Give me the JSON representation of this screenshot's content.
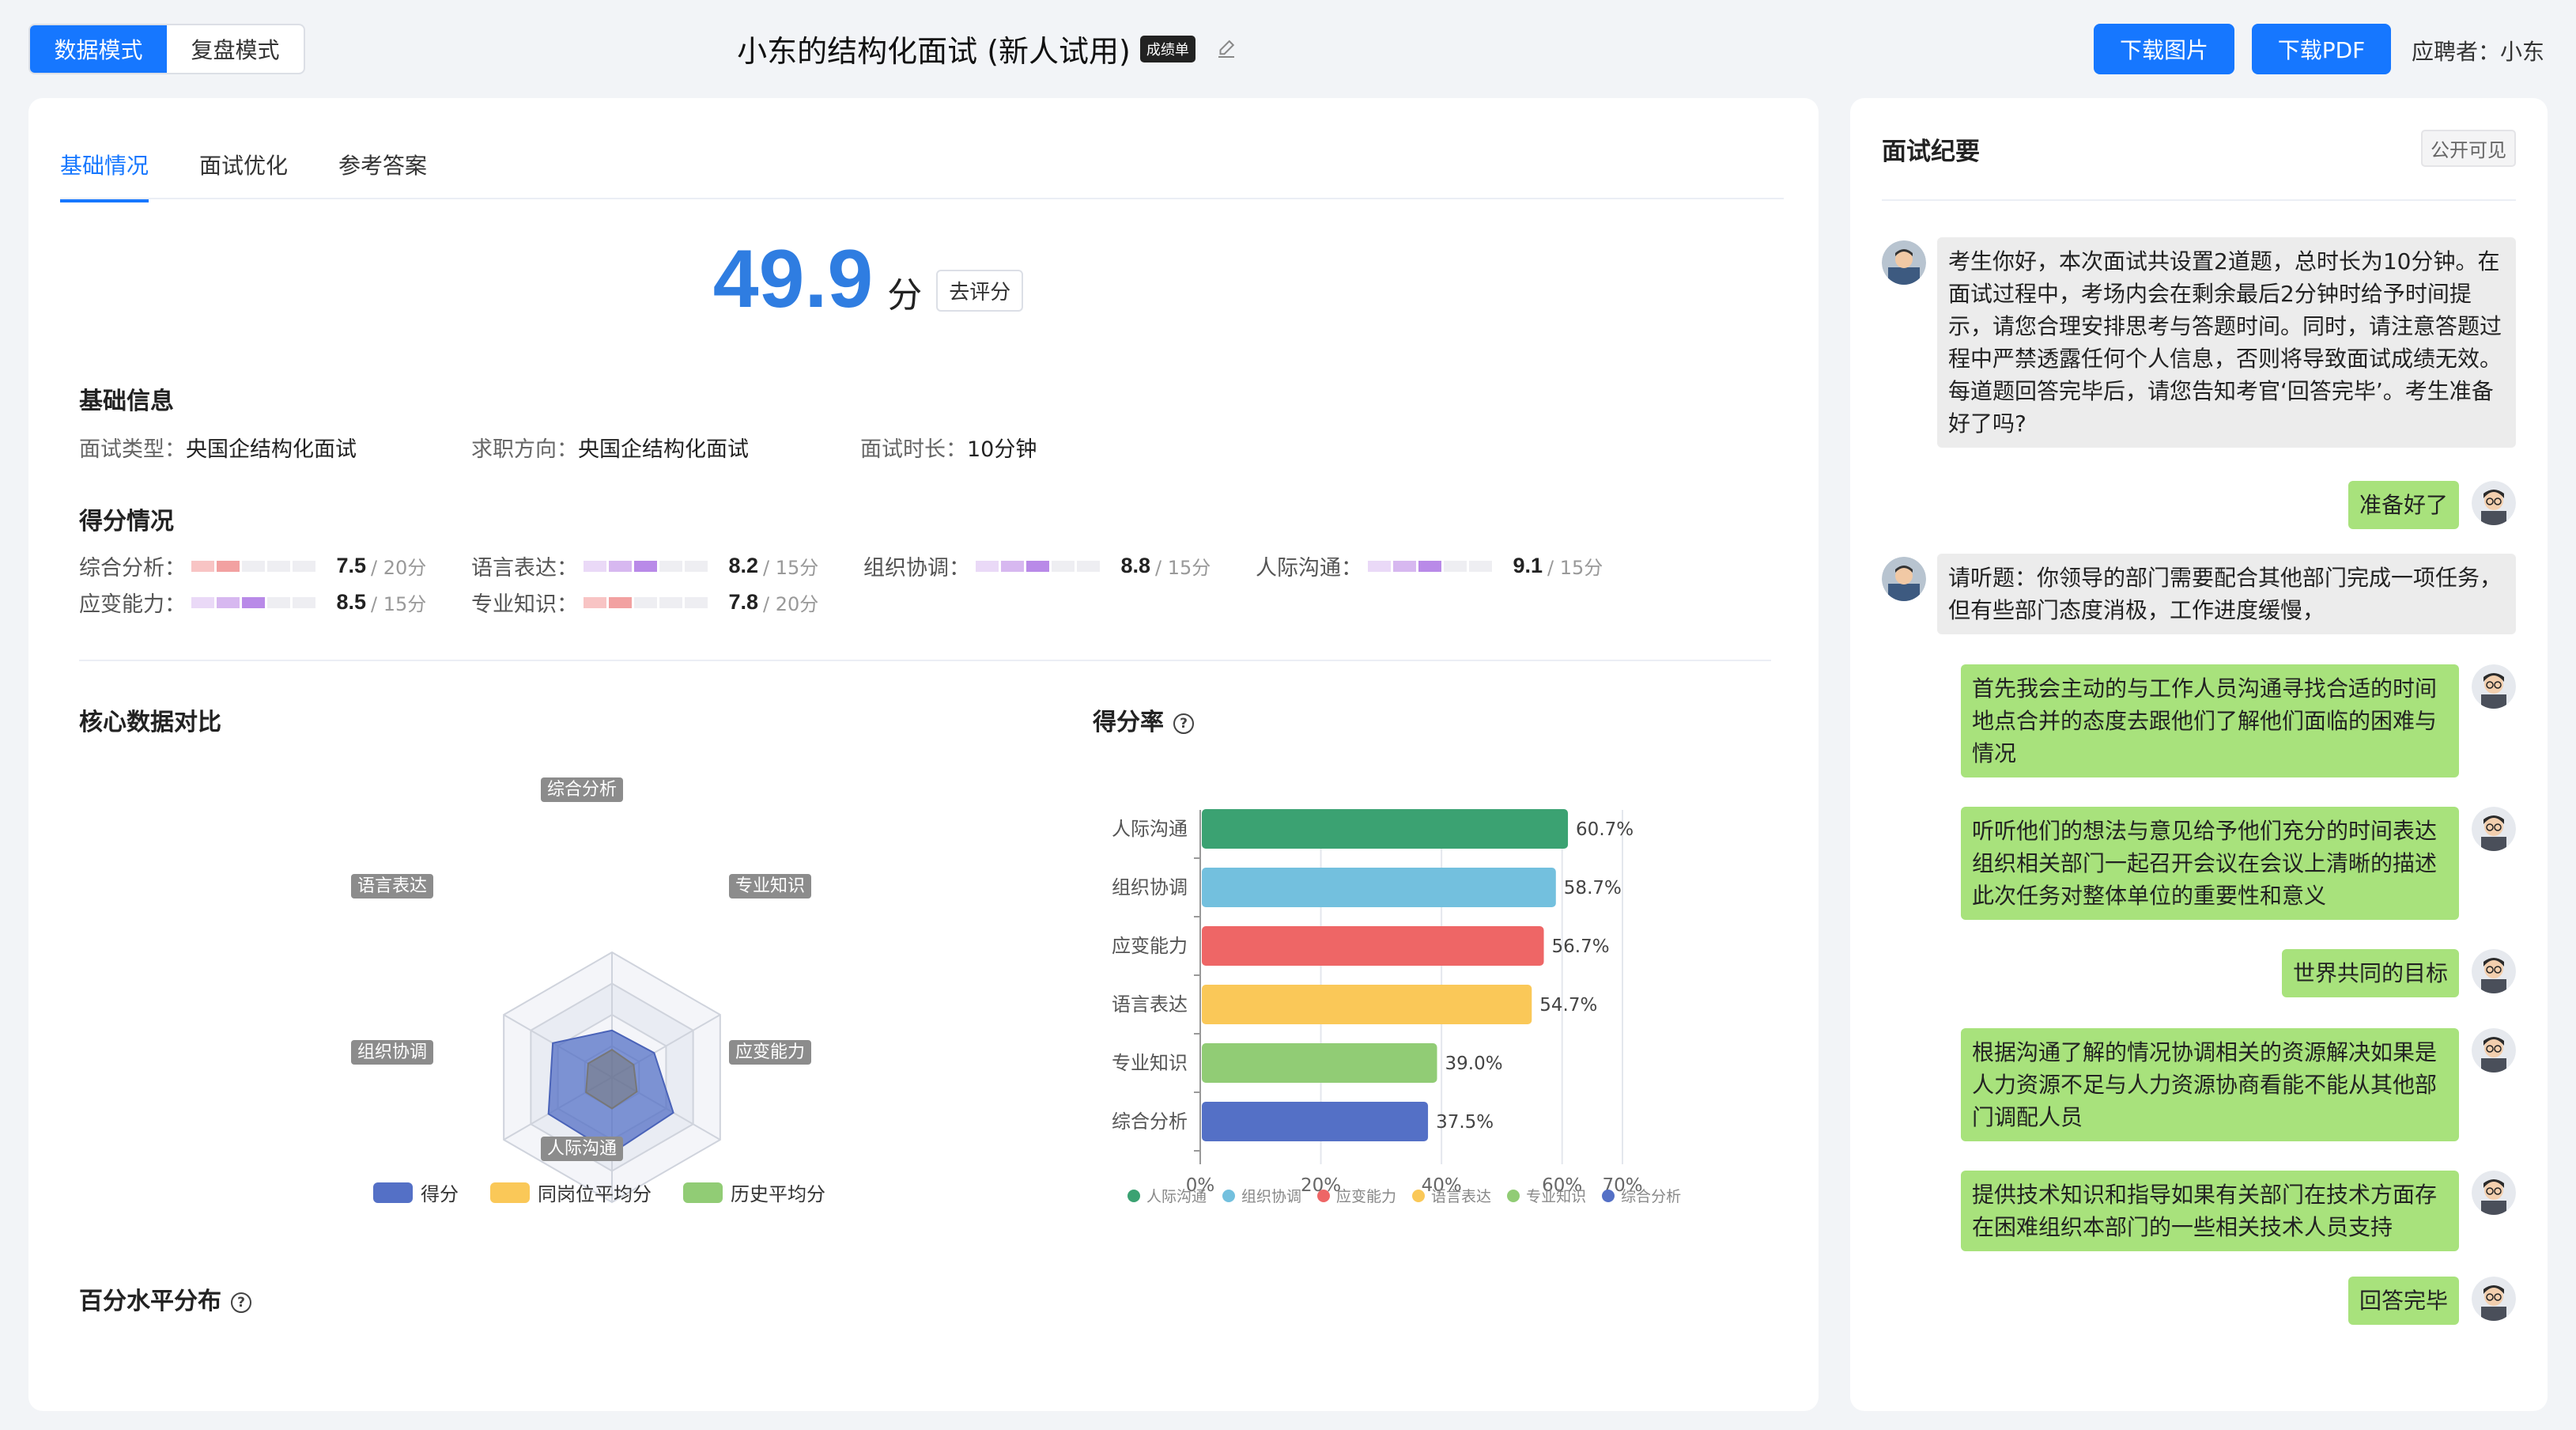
{
  "header": {
    "mode_data": "数据模式",
    "mode_review": "复盘模式",
    "title": "小东的结构化面试 (新人试用)",
    "title_badge": "成绩单",
    "download_image": "下载图片",
    "download_pdf": "下载PDF",
    "candidate": "应聘者：小东"
  },
  "tabs": [
    "基础情况",
    "面试优化",
    "参考答案"
  ],
  "score": {
    "value": "49.9",
    "unit": "分",
    "rate_button": "去评分"
  },
  "basic_info": {
    "title": "基础信息",
    "items": [
      {
        "label": "面试类型：",
        "value": "央国企结构化面试"
      },
      {
        "label": "求职方向：",
        "value": "央国企结构化面试"
      },
      {
        "label": "面试时长：",
        "value": "10分钟"
      }
    ]
  },
  "score_section": {
    "title": "得分情况",
    "items": [
      {
        "label": "综合分析：",
        "score": "7.5",
        "max": "/ 20分",
        "colors": [
          "#f8c4c4",
          "#f2a1a1",
          "#eeeef2",
          "#eeeef2",
          "#eeeef2"
        ]
      },
      {
        "label": "语言表达：",
        "score": "8.2",
        "max": "/ 15分",
        "colors": [
          "#ead9f7",
          "#d7b8f0",
          "#b98ae8",
          "#eeeef2",
          "#eeeef2"
        ]
      },
      {
        "label": "组织协调：",
        "score": "8.8",
        "max": "/ 15分",
        "colors": [
          "#ead9f7",
          "#d7b8f0",
          "#b98ae8",
          "#eeeef2",
          "#eeeef2"
        ]
      },
      {
        "label": "人际沟通：",
        "score": "9.1",
        "max": "/ 15分",
        "colors": [
          "#ead9f7",
          "#d7b8f0",
          "#b98ae8",
          "#eeeef2",
          "#eeeef2"
        ]
      },
      {
        "label": "应变能力：",
        "score": "8.5",
        "max": "/ 15分",
        "colors": [
          "#ead9f7",
          "#d7b8f0",
          "#b98ae8",
          "#eeeef2",
          "#eeeef2"
        ]
      },
      {
        "label": "专业知识：",
        "score": "7.8",
        "max": "/ 20分",
        "colors": [
          "#f8c4c4",
          "#f2a1a1",
          "#eeeef2",
          "#eeeef2",
          "#eeeef2"
        ]
      }
    ]
  },
  "core_compare": {
    "title": "核心数据对比",
    "axes": [
      "综合分析",
      "专业知识",
      "应变能力",
      "人际沟通",
      "组织协调",
      "语言表达"
    ],
    "legend": [
      {
        "name": "得分",
        "color": "#5470c6"
      },
      {
        "name": "同岗位平均分",
        "color": "#fac858"
      },
      {
        "name": "历史平均分",
        "color": "#91cc75"
      }
    ]
  },
  "score_rate": {
    "title": "得分率"
  },
  "percentile": {
    "title": "百分水平分布"
  },
  "chart_data": [
    {
      "type": "radar",
      "title": "核心数据对比",
      "axes": [
        "综合分析",
        "专业知识",
        "应变能力",
        "人际沟通",
        "组织协调",
        "语言表达"
      ],
      "series": [
        {
          "name": "得分",
          "values": [
            0.375,
            0.39,
            0.567,
            0.607,
            0.587,
            0.547
          ]
        },
        {
          "name": "历史平均分",
          "values": [
            0.22,
            0.2,
            0.23,
            0.25,
            0.24,
            0.22
          ]
        }
      ]
    },
    {
      "type": "bar",
      "orientation": "horizontal",
      "title": "得分率",
      "categories": [
        "人际沟通",
        "组织协调",
        "应变能力",
        "语言表达",
        "专业知识",
        "综合分析"
      ],
      "values": [
        60.7,
        58.7,
        56.7,
        54.7,
        39.0,
        37.5
      ],
      "labels": [
        "60.7%",
        "58.7%",
        "56.7%",
        "54.7%",
        "39.0%",
        "37.5%"
      ],
      "colors": [
        "#3ba272",
        "#73c0de",
        "#ee6666",
        "#fac858",
        "#91cc75",
        "#5470c6"
      ],
      "xticks": [
        "0%",
        "20%",
        "40%",
        "60%",
        "70%"
      ],
      "xtick_values": [
        0,
        20,
        40,
        60,
        70
      ],
      "xlim": [
        0,
        70
      ]
    }
  ],
  "minutes": {
    "title": "面试纪要",
    "visibility": "公开可见",
    "messages": [
      {
        "role": "interviewer",
        "text": "考生你好，本次面试共设置2道题，总时长为10分钟。在面试过程中，考场内会在剩余最后2分钟时给予时间提示，请您合理安排思考与答题时间。同时，请注意答题过程中严禁透露任何个人信息，否则将导致面试成绩无效。每道题回答完毕后，请您告知考官‘回答完毕’。考生准备好了吗?"
      },
      {
        "role": "candidate",
        "text": "准备好了"
      },
      {
        "role": "interviewer",
        "text": "请听题：你领导的部门需要配合其他部门完成一项任务，但有些部门态度消极，工作进度缓慢，"
      },
      {
        "role": "candidate",
        "text": "首先我会主动的与工作人员沟通寻找合适的时间地点合并的态度去跟他们了解他们面临的困难与情况"
      },
      {
        "role": "candidate",
        "text": "听听他们的想法与意见给予他们充分的时间表达组织相关部门一起召开会议在会议上清晰的描述此次任务对整体单位的重要性和意义"
      },
      {
        "role": "candidate",
        "text": "世界共同的目标"
      },
      {
        "role": "candidate",
        "text": "根据沟通了解的情况协调相关的资源解决如果是人力资源不足与人力资源协商看能不能从其他部门调配人员"
      },
      {
        "role": "candidate",
        "text": "提供技术知识和指导如果有关部门在技术方面存在困难组织本部门的一些相关技术人员支持"
      },
      {
        "role": "candidate",
        "text": "回答完毕"
      }
    ]
  }
}
